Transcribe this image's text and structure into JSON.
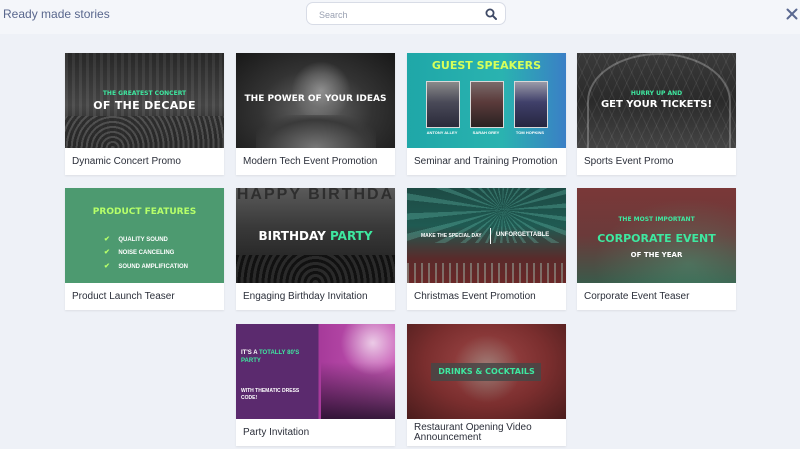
{
  "header": {
    "title": "Ready made stories",
    "search_placeholder": "Search"
  },
  "cards": [
    {
      "title": "Dynamic Concert Promo",
      "thumb": {
        "line1": "THE GREATEST CONCERT",
        "line2": "OF THE DECADE"
      }
    },
    {
      "title": "Modern Tech Event Promotion",
      "thumb": {
        "line1": "THE POWER OF YOUR IDEAS"
      }
    },
    {
      "title": "Seminar and Training Promotion",
      "thumb": {
        "heading": "GUEST SPEAKERS",
        "speakers": [
          "ANTONY ALLEY",
          "SARAH GREY",
          "TOM HOPKINS"
        ]
      }
    },
    {
      "title": "Sports Event Promo",
      "thumb": {
        "line1": "HURRY UP AND",
        "line2": "GET YOUR TICKETS!"
      }
    },
    {
      "title": "Product Launch Teaser",
      "thumb": {
        "heading": "PRODUCT FEATURES",
        "features": [
          "QUALITY SOUND",
          "NOISE CANCELING",
          "SOUND AMPLIFICATION"
        ]
      }
    },
    {
      "title": "Engaging Birthday Invitation",
      "thumb": {
        "bg_text": "HAPPY BIRTHDA",
        "line1": "BIRTHDAY",
        "line2": "PARTY"
      }
    },
    {
      "title": "Christmas Event Promotion",
      "thumb": {
        "line1": "MAKE THE SPECIAL DAY",
        "line2": "UNFORGETTABLE"
      }
    },
    {
      "title": "Corporate Event Teaser",
      "thumb": {
        "line1": "THE MOST IMPORTANT",
        "line2": "CORPORATE EVENT",
        "line3": "OF THE YEAR"
      }
    },
    {
      "title": "Party Invitation",
      "thumb": {
        "line1": "IT'S A",
        "line1b": "TOTALLY 80'S",
        "line2": "PARTY",
        "line3": "WITH THEMATIC DRESS",
        "line4": "CODE!"
      }
    },
    {
      "title": "Restaurant Opening Video Announcement",
      "thumb": {
        "line1": "DRINKS & COCKTAILS"
      }
    }
  ],
  "colors": {
    "accent_green": "#3ee8a0",
    "teal": "#2ab3b0",
    "header_text": "#59678d"
  },
  "icons": [
    "search-icon",
    "close-icon",
    "checkmark-icon"
  ]
}
